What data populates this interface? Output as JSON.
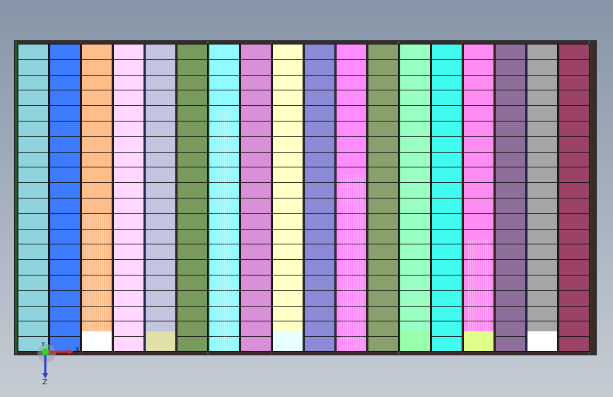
{
  "scene": {
    "view": "front",
    "module_colors": [
      "#8fd3dd",
      "#3e7cff",
      "#ffbd8a",
      "#ffd7ff",
      "#c3c4e0",
      "#789a5c",
      "#8ffaff",
      "#da90d8",
      "#ffffc6",
      "#8a8ad6",
      "#ff8cff",
      "#87a06c",
      "#99ffc3",
      "#40fbf0",
      "#ff8cf2",
      "#8e6f9a",
      "#a6a6a6",
      "#9c4267"
    ],
    "foot_colors": [
      "",
      "",
      "#ffffff",
      "",
      "#e0e0a8",
      "",
      "",
      "",
      "#e8ffff",
      "",
      "",
      "",
      "#99ffaa",
      "",
      "#e0ff8a",
      "",
      "#ffffff",
      ""
    ],
    "rows_per_column": 20
  },
  "triad": {
    "x_label": "X",
    "y_label": "Y",
    "z_label": "Z"
  }
}
